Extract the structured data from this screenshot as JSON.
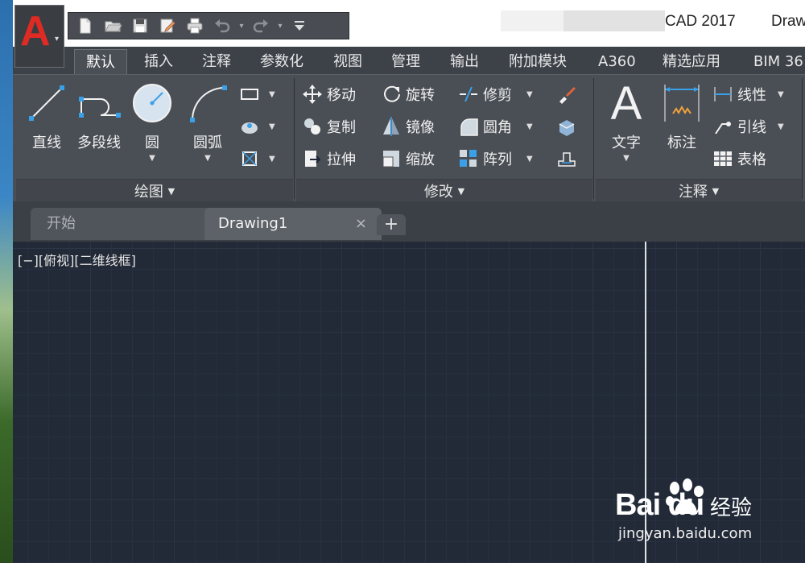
{
  "window": {
    "title": "CAD 2017",
    "document_title_fragment": "Draw",
    "logo_letter": "A"
  },
  "quick_access": [
    {
      "icon": "new-file-icon"
    },
    {
      "icon": "open-folder-icon"
    },
    {
      "icon": "save-icon"
    },
    {
      "icon": "save-as-icon"
    },
    {
      "icon": "print-icon"
    },
    {
      "icon": "undo-icon"
    },
    {
      "icon": "redo-icon"
    },
    {
      "icon": "customize-dropdown-icon"
    }
  ],
  "ribbon_tabs": [
    {
      "label": "默认",
      "active": true
    },
    {
      "label": "插入"
    },
    {
      "label": "注释"
    },
    {
      "label": "参数化"
    },
    {
      "label": "视图"
    },
    {
      "label": "管理"
    },
    {
      "label": "输出"
    },
    {
      "label": "附加模块"
    },
    {
      "label": "A360"
    },
    {
      "label": "精选应用"
    },
    {
      "label": "BIM 36"
    }
  ],
  "panels": {
    "draw": {
      "footer": "绘图",
      "buttons": [
        "直线",
        "多段线",
        "圆",
        "圆弧"
      ]
    },
    "modify": {
      "footer": "修改",
      "rows": [
        [
          "移动",
          "旋转",
          "修剪"
        ],
        [
          "复制",
          "镜像",
          "圆角"
        ],
        [
          "拉伸",
          "缩放",
          "阵列"
        ]
      ]
    },
    "annotation": {
      "footer": "注释",
      "big": [
        "文字",
        "标注"
      ],
      "rows": [
        "线性",
        "引线",
        "表格"
      ]
    }
  },
  "doc_tabs": {
    "start": "开始",
    "drawing": "Drawing1",
    "close": "×",
    "new": "+"
  },
  "viewport": {
    "label": "[−][俯视][二维线框]"
  },
  "watermark": {
    "brand": "Bai du",
    "jingyan": "经验",
    "url": "jingyan.baidu.com"
  },
  "colors": {
    "canvas": "#222a37",
    "ribbon": "#4a4e55",
    "logo_red": "#e02b24",
    "accent_blue": "#3aa0e8"
  }
}
